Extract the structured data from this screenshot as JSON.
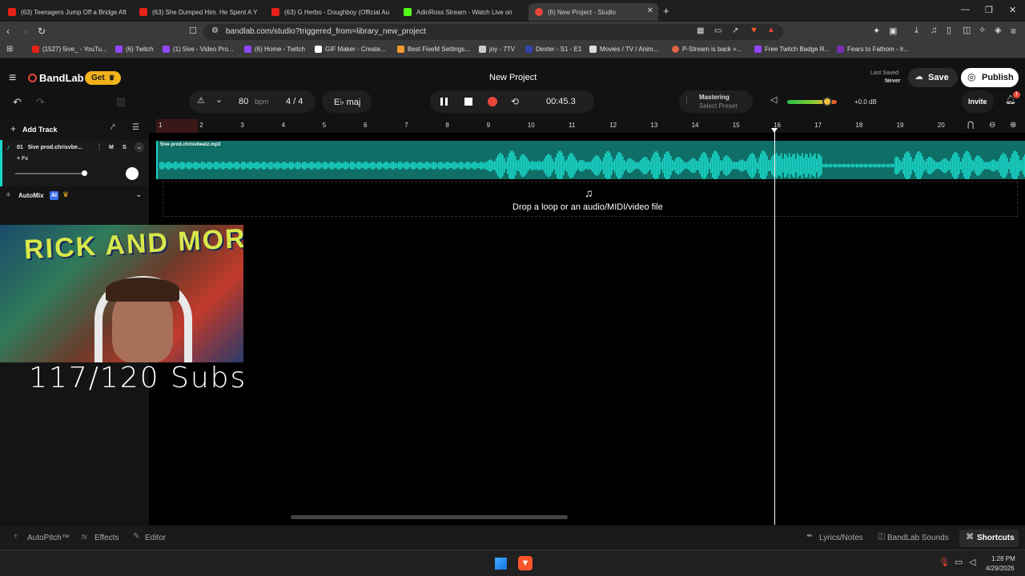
{
  "browser": {
    "tabs": [
      {
        "title": "(63) Teenagers Jump Off a Bridge Aft",
        "icon": "youtube-icon",
        "color": "#e62117"
      },
      {
        "title": "(63) She Dumped Him. He Spent A Y",
        "icon": "youtube-icon",
        "color": "#e62117"
      },
      {
        "title": "(63) G Herbo - Doughboy (Official Au",
        "icon": "youtube-icon",
        "color": "#e62117"
      },
      {
        "title": "AdinRoss Stream - Watch Live on",
        "icon": "kick-icon",
        "color": "#53fc18"
      },
      {
        "title": "(6) New Project - Studio",
        "icon": "bandlab-icon",
        "color": "#e8473a"
      }
    ],
    "url": "bandlab.com/studio?triggered_from=library_new_project",
    "bookmarks": [
      {
        "label": "(1527) 5ive_ - YouTu...",
        "color": "#e62117"
      },
      {
        "label": "(6) Twitch",
        "color": "#9146ff"
      },
      {
        "label": "(1) 5ive - Video Pro...",
        "color": "#9146ff"
      },
      {
        "label": "(6) Home - Twitch",
        "color": "#9146ff"
      },
      {
        "label": "GIF Maker - Create...",
        "color": "#ffffff"
      },
      {
        "label": "Best FiveM Settings...",
        "color": "#f29a2e"
      },
      {
        "label": "joy - 7TV",
        "color": "#cccccc"
      },
      {
        "label": "Dexter - S1 - E1",
        "color": "#3344aa"
      },
      {
        "label": "Movies / TV / Anim...",
        "color": "#dddddd"
      },
      {
        "label": "P-Stream is back +...",
        "color": "#e0664a"
      },
      {
        "label": "Free Twitch Badge R...",
        "color": "#9146ff"
      },
      {
        "label": "Fears to Fathom - Ir...",
        "color": "#7a2fb3"
      }
    ]
  },
  "app": {
    "brand": "BandLab",
    "get_label": "Get",
    "project_title": "New Project",
    "last_saved_label": "Last Saved",
    "last_saved_value": "Never",
    "save_label": "Save",
    "publish_label": "Publish",
    "tempo": "80",
    "tempo_unit": "bpm",
    "time_signature": "4 / 4",
    "key": "E♭ maj",
    "time_display": "00:45.3",
    "mastering_label": "Mastering",
    "mastering_preset": "Select Preset",
    "volume_db": "+0.0 dB",
    "volume_level": 0.8,
    "invite_label": "Invite",
    "notification_count": "1",
    "add_track_label": "Add Track",
    "track": {
      "number": "01",
      "name": "5ive prod.chrisvbe...",
      "mute": "M",
      "solo": "S",
      "fx": "+ Fx",
      "clip_name": "5ive prod.chrisvbeatz.mp3"
    },
    "automix_label": "AutoMix",
    "automix_badge": "AI",
    "drop_hint": "Drop a loop or an audio/MIDI/video file",
    "ruler_ticks": [
      "1",
      "2",
      "3",
      "4",
      "5",
      "6",
      "7",
      "8",
      "9",
      "10",
      "11",
      "12",
      "13",
      "14",
      "15",
      "16",
      "17",
      "18",
      "19",
      "20"
    ],
    "bottom_left": [
      "AutoPitch™",
      "Effects",
      "Editor"
    ],
    "bottom_right": [
      "Lyrics/Notes",
      "BandLab Sounds",
      "Shortcuts"
    ]
  },
  "overlay": {
    "subs_text": "117/120 Subs",
    "webcam_banner": "RICK AND MORTY"
  },
  "taskbar": {
    "time": "1:28 PM",
    "date": "4/29/2026"
  },
  "colors": {
    "accent": "#e8473a",
    "waveform": "#19d6c8",
    "clip_bg": "#0f6e66",
    "get_badge": "#f2b21b"
  }
}
